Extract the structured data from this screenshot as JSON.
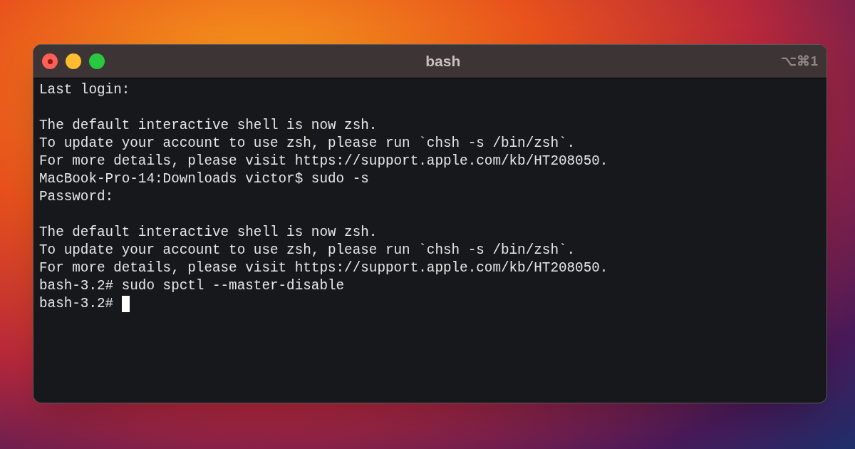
{
  "window": {
    "title": "bash",
    "shortcut": "⌥⌘1"
  },
  "lines": [
    {
      "kind": "text",
      "text": "Last login:"
    },
    {
      "kind": "blank"
    },
    {
      "kind": "text",
      "text": "The default interactive shell is now zsh."
    },
    {
      "kind": "text",
      "text": "To update your account to use zsh, please run `chsh -s /bin/zsh`."
    },
    {
      "kind": "text",
      "text": "For more details, please visit https://support.apple.com/kb/HT208050."
    },
    {
      "kind": "text",
      "text": "MacBook-Pro-14:Downloads victor$ sudo -s"
    },
    {
      "kind": "text",
      "text": "Password:"
    },
    {
      "kind": "blank"
    },
    {
      "kind": "text",
      "text": "The default interactive shell is now zsh."
    },
    {
      "kind": "text",
      "text": "To update your account to use zsh, please run `chsh -s /bin/zsh`."
    },
    {
      "kind": "text",
      "text": "For more details, please visit https://support.apple.com/kb/HT208050."
    },
    {
      "kind": "text",
      "text": "bash-3.2# sudo spctl --master-disable"
    }
  ],
  "prompt": {
    "text": "bash-3.2#",
    "cursor": true
  }
}
